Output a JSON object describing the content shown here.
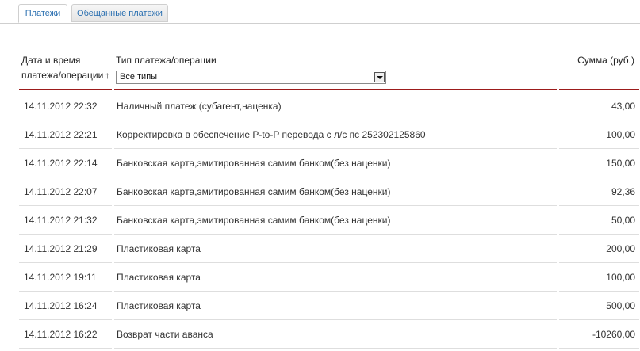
{
  "tabs": [
    {
      "label": "Платежи",
      "active": true
    },
    {
      "label": "Обещанные платежи",
      "active": false
    }
  ],
  "table": {
    "col_date": "Дата и время платежа/операции",
    "sort_arrow": "↑",
    "col_type": "Тип платежа/операции",
    "col_sum": "Сумма (руб.)",
    "filter": {
      "selected": "Все типы"
    },
    "rows": [
      {
        "date": "14.11.2012 22:32",
        "type": "Наличный платеж (субагент,наценка)",
        "sum": "43,00"
      },
      {
        "date": "14.11.2012 22:21",
        "type": "Корректировка в обеспечение P-to-P перевода с л/с пс 252302125860",
        "sum": "100,00"
      },
      {
        "date": "14.11.2012 22:14",
        "type": "Банковская карта,эмитированная самим банком(без наценки)",
        "sum": "150,00"
      },
      {
        "date": "14.11.2012 22:07",
        "type": "Банковская карта,эмитированная самим банком(без наценки)",
        "sum": "92,36"
      },
      {
        "date": "14.11.2012 21:32",
        "type": "Банковская карта,эмитированная самим банком(без наценки)",
        "sum": "50,00"
      },
      {
        "date": "14.11.2012 21:29",
        "type": "Пластиковая карта",
        "sum": "200,00"
      },
      {
        "date": "14.11.2012 19:11",
        "type": "Пластиковая карта",
        "sum": "100,00"
      },
      {
        "date": "14.11.2012 16:24",
        "type": "Пластиковая карта",
        "sum": "500,00"
      },
      {
        "date": "14.11.2012 16:22",
        "type": "Возврат части аванса",
        "sum": "-10260,00"
      }
    ]
  },
  "colors": {
    "accent_line": "#9c1b1b",
    "link": "#2a6fb0"
  }
}
